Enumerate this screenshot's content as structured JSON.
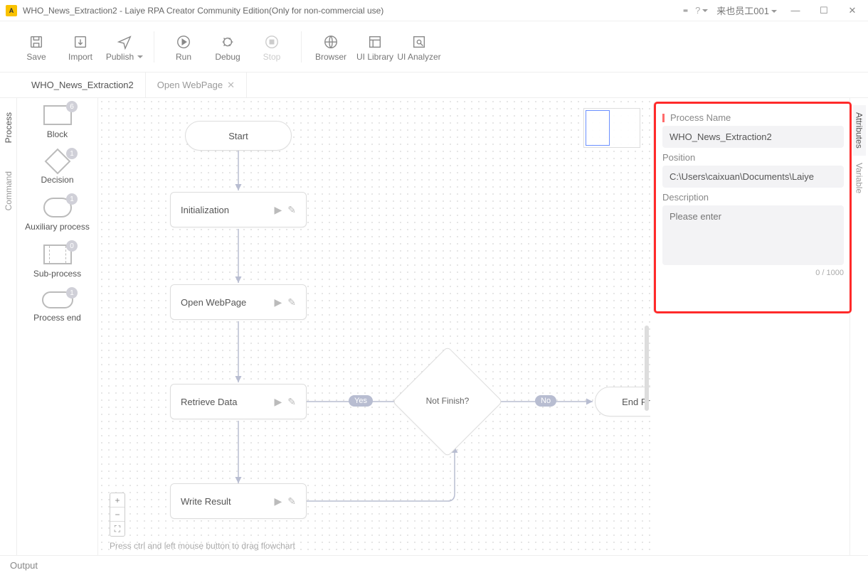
{
  "titlebar": {
    "title": "WHO_News_Extraction2 - Laiye RPA Creator Community Edition(Only for non-commercial use)",
    "user": "来也员工001"
  },
  "toolbar": {
    "save": "Save",
    "import": "Import",
    "publish": "Publish",
    "run": "Run",
    "debug": "Debug",
    "stop": "Stop",
    "browser": "Browser",
    "uilibrary": "UI Library",
    "uianalyzer": "UI Analyzer"
  },
  "tabs": [
    {
      "label": "WHO_News_Extraction2",
      "active": true,
      "closable": false
    },
    {
      "label": "Open WebPage",
      "active": false,
      "closable": true
    }
  ],
  "leftRail": {
    "process": "Process",
    "command": "Command"
  },
  "palette": [
    {
      "name": "Block",
      "badge": "6",
      "shape": "block"
    },
    {
      "name": "Decision",
      "badge": "1",
      "shape": "decision"
    },
    {
      "name": "Auxiliary process",
      "badge": "1",
      "shape": "aux"
    },
    {
      "name": "Sub-process",
      "badge": "0",
      "shape": "sub"
    },
    {
      "name": "Process end",
      "badge": "1",
      "shape": "end"
    }
  ],
  "flow": {
    "start": "Start",
    "init": "Initialization",
    "open": "Open WebPage",
    "retrieve": "Retrieve Data",
    "write": "Write Result",
    "decision": "Not Finish?",
    "end": "End Process",
    "yes": "Yes",
    "no": "No"
  },
  "hint": "Press ctrl and left mouse button to drag flowchart",
  "attributes": {
    "pname_label": "Process Name",
    "pname_value": "WHO_News_Extraction2",
    "pos_label": "Position",
    "pos_value": "C:\\Users\\caixuan\\Documents\\Laiye",
    "desc_label": "Description",
    "desc_placeholder": "Please enter",
    "counter": "0 / 1000"
  },
  "rightRail": {
    "attributes": "Attributes",
    "variable": "Variable"
  },
  "statusbar": {
    "output": "Output"
  }
}
